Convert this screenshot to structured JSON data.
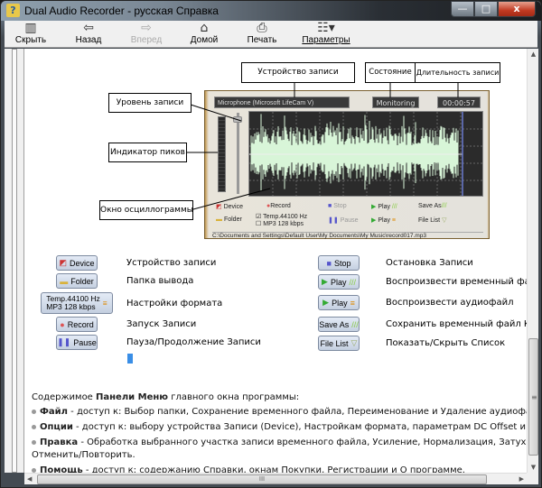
{
  "window": {
    "title": "Dual Audio Recorder - русская Справка",
    "controls": {
      "minimize": "—",
      "maximize": "□",
      "close": "x"
    }
  },
  "toolbar": {
    "items": [
      {
        "label": "Скрыть",
        "icon": "hide-pane-icon",
        "glyph": "▥",
        "enabled": true
      },
      {
        "label": "Назад",
        "icon": "back-arrow-icon",
        "glyph": "⇦",
        "enabled": true
      },
      {
        "label": "Вперед",
        "icon": "forward-arrow-icon",
        "glyph": "⇨",
        "enabled": false
      },
      {
        "label": "Домой",
        "icon": "home-icon",
        "glyph": "⌂",
        "enabled": true
      },
      {
        "label": "Печать",
        "icon": "printer-icon",
        "glyph": "⎙",
        "enabled": true
      },
      {
        "label": "Параметры",
        "icon": "options-icon",
        "glyph": "☷▾",
        "enabled": true
      }
    ]
  },
  "diagram": {
    "device_text": "Microphone (Microsoft LifeCam V)",
    "state_text": "Monitoring",
    "time_text": "00:00:57",
    "controls": {
      "device": "Device",
      "record": "Record",
      "stop": "Stop",
      "play1": "Play",
      "save_as": "Save As",
      "folder": "Folder",
      "temp": "Temp.44100 Hz",
      "mp3": "MP3 128 kbps",
      "pause": "Pause",
      "play2": "Play",
      "file_list": "File List"
    },
    "path": "C:\\Documents and Settings\\Default User\\My Documents\\My Music\\record017.mp3",
    "callouts": {
      "device": "Устройство записи",
      "state": "Состояние",
      "duration": "Длительность записи",
      "level": "Уровень записи",
      "peak": "Индикатор пиков",
      "wave": "Окно осциллограммы"
    }
  },
  "buttons_left": [
    {
      "label": "Device",
      "desc": "Устройство записи",
      "icon": "device-icon"
    },
    {
      "label": "Folder",
      "desc": "Папка вывода",
      "icon": "folder-icon"
    },
    {
      "label": "Temp.44100 Hz",
      "label2": "MP3 128 kbps",
      "desc": "Настройки формата",
      "icon": "format-icon"
    },
    {
      "label": "Record",
      "desc": "Запуск Записи",
      "icon": "record-icon"
    },
    {
      "label": "Pause",
      "desc": "Пауза/Продолжение Записи",
      "icon": "pause-icon"
    }
  ],
  "buttons_right": [
    {
      "label": "Stop",
      "desc": "Остановка Записи",
      "icon": "stop-icon"
    },
    {
      "label": "Play",
      "desc": "Воспроизвести временный файл",
      "icon": "play-temp-icon"
    },
    {
      "label": "Play",
      "desc": "Воспроизвести аудиофайл",
      "icon": "play-file-icon"
    },
    {
      "label": "Save As",
      "desc": "Сохранить временный файл Как...",
      "icon": "save-as-icon"
    },
    {
      "label": "File List",
      "desc": "Показать/Скрыть Список",
      "icon": "file-list-icon"
    }
  ],
  "menu_section": {
    "intro_a": "Содержимое ",
    "intro_b": "Панели Меню",
    "intro_c": " главного окна программы:",
    "items": [
      {
        "name": "Файл",
        "text": " - доступ к: Выбор папки, Сохранение временного файла, Переименование и Удаление аудиофайла."
      },
      {
        "name": "Опции",
        "text": " - доступ к: выбору устройства Записи (Device), Настройкам формата, параметрам DC Offset и Затуханию In/o"
      },
      {
        "name": "Правка",
        "text": " - Обработка выбранного участка записи временного файла, Усиление, Нормализация, Затухание in/out,",
        "text2": "Отменить/Повторить."
      },
      {
        "name": "Помощь",
        "text": " - доступ к: содержанию Справки, окнам Покупки, Регистрации и О программе."
      }
    ]
  },
  "scroll": {
    "vertical_position": 0.72,
    "horizontal_grip": "III"
  }
}
